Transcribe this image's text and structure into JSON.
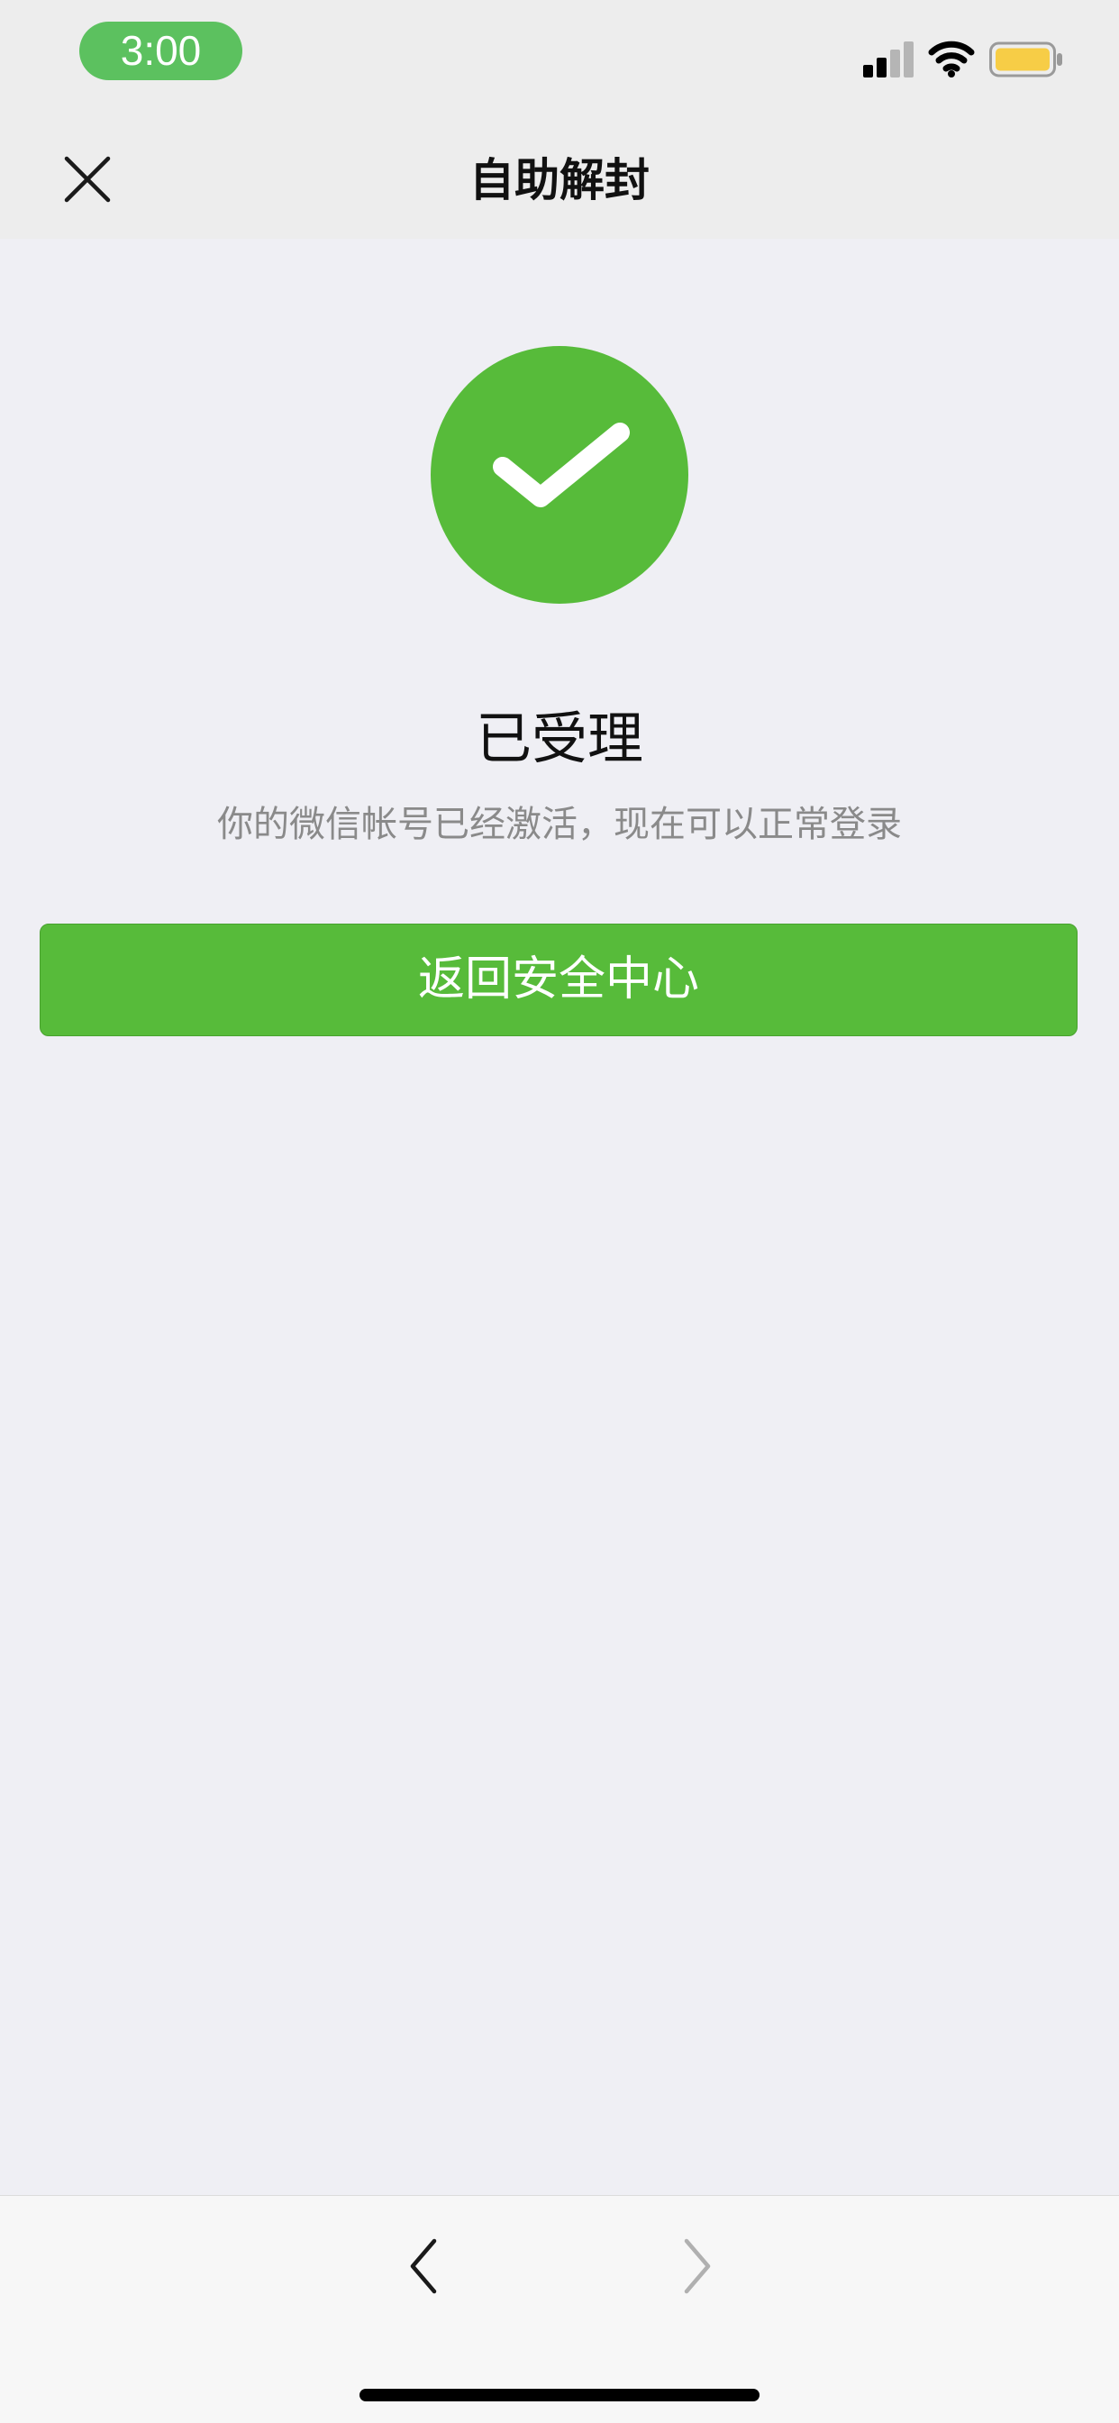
{
  "status_bar": {
    "time": "3:00",
    "time_pill_color": "#5cc15f",
    "icons": [
      "signal-icon",
      "wifi-icon",
      "battery-icon"
    ],
    "battery_color": "#f7cd46"
  },
  "nav": {
    "title": "自助解封",
    "close_icon": "close-icon"
  },
  "result": {
    "icon": "checkmark-icon",
    "accent_color": "#57bb3a",
    "title": "已受理",
    "description": "你的微信帐号已经激活，现在可以正常登录"
  },
  "actions": {
    "primary_label": "返回安全中心"
  },
  "toolbar": {
    "back_icon": "chevron-left-icon",
    "forward_icon": "chevron-right-icon"
  }
}
